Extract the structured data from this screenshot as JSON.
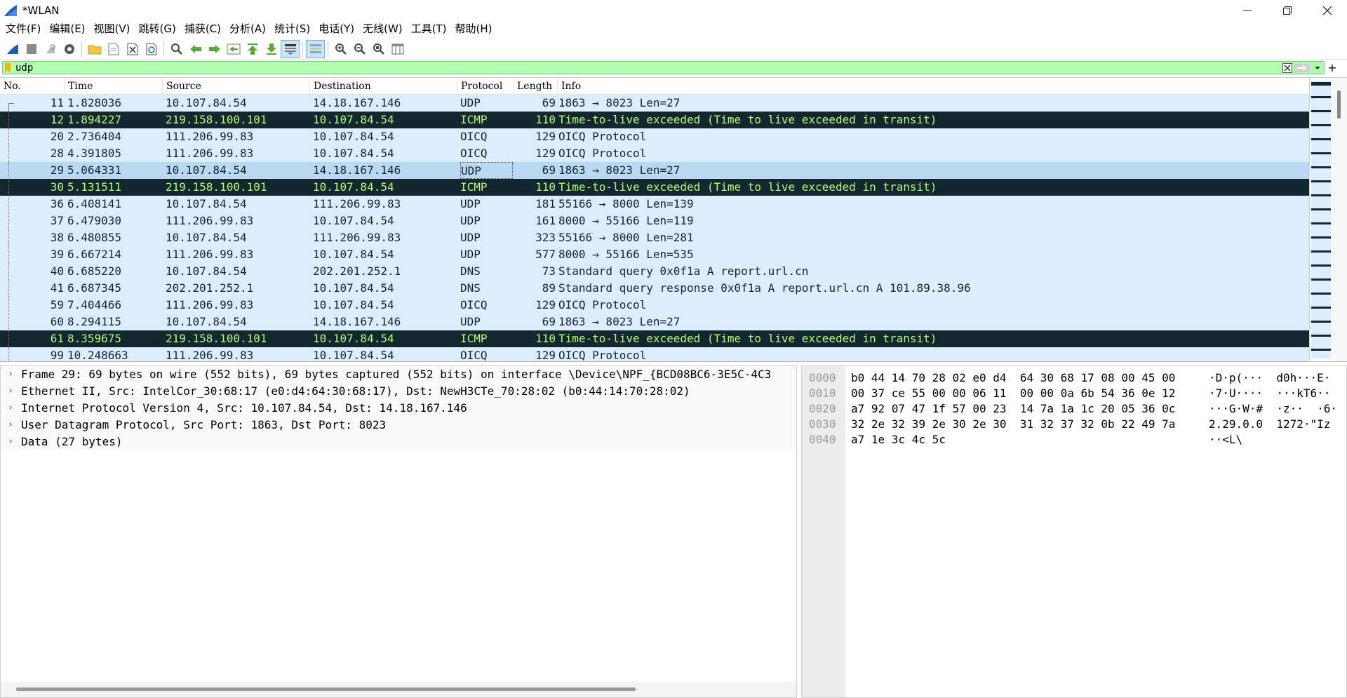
{
  "window": {
    "title": "*WLAN"
  },
  "menu": [
    "文件(F)",
    "编辑(E)",
    "视图(V)",
    "跳转(G)",
    "捕获(C)",
    "分析(A)",
    "统计(S)",
    "电话(Y)",
    "无线(W)",
    "工具(T)",
    "帮助(H)"
  ],
  "filter": {
    "value": "udp",
    "add_label": "+"
  },
  "columns": [
    "No.",
    "Time",
    "Source",
    "Destination",
    "Protocol",
    "Length",
    "Info"
  ],
  "packets": [
    {
      "no": "11",
      "time": "1.828036",
      "src": "10.107.84.54",
      "dst": "14.18.167.146",
      "proto": "UDP",
      "len": "69",
      "info": "1863 → 8023 Len=27"
    },
    {
      "no": "12",
      "time": "1.894227",
      "src": "219.158.100.101",
      "dst": "10.107.84.54",
      "proto": "ICMP",
      "len": "110",
      "info": "Time-to-live exceeded (Time to live exceeded in transit)"
    },
    {
      "no": "20",
      "time": "2.736404",
      "src": "111.206.99.83",
      "dst": "10.107.84.54",
      "proto": "OICQ",
      "len": "129",
      "info": "OICQ Protocol"
    },
    {
      "no": "28",
      "time": "4.391805",
      "src": "111.206.99.83",
      "dst": "10.107.84.54",
      "proto": "OICQ",
      "len": "129",
      "info": "OICQ Protocol"
    },
    {
      "no": "29",
      "time": "5.064331",
      "src": "10.107.84.54",
      "dst": "14.18.167.146",
      "proto": "UDP",
      "len": "69",
      "info": "1863 → 8023 Len=27"
    },
    {
      "no": "30",
      "time": "5.131511",
      "src": "219.158.100.101",
      "dst": "10.107.84.54",
      "proto": "ICMP",
      "len": "110",
      "info": "Time-to-live exceeded (Time to live exceeded in transit)"
    },
    {
      "no": "36",
      "time": "6.408141",
      "src": "10.107.84.54",
      "dst": "111.206.99.83",
      "proto": "UDP",
      "len": "181",
      "info": "55166 → 8000 Len=139"
    },
    {
      "no": "37",
      "time": "6.479030",
      "src": "111.206.99.83",
      "dst": "10.107.84.54",
      "proto": "UDP",
      "len": "161",
      "info": "8000 → 55166 Len=119"
    },
    {
      "no": "38",
      "time": "6.480855",
      "src": "10.107.84.54",
      "dst": "111.206.99.83",
      "proto": "UDP",
      "len": "323",
      "info": "55166 → 8000 Len=281"
    },
    {
      "no": "39",
      "time": "6.667214",
      "src": "111.206.99.83",
      "dst": "10.107.84.54",
      "proto": "UDP",
      "len": "577",
      "info": "8000 → 55166 Len=535"
    },
    {
      "no": "40",
      "time": "6.685220",
      "src": "10.107.84.54",
      "dst": "202.201.252.1",
      "proto": "DNS",
      "len": "73",
      "info": "Standard query 0x0f1a A report.url.cn"
    },
    {
      "no": "41",
      "time": "6.687345",
      "src": "202.201.252.1",
      "dst": "10.107.84.54",
      "proto": "DNS",
      "len": "89",
      "info": "Standard query response 0x0f1a A report.url.cn A 101.89.38.96"
    },
    {
      "no": "59",
      "time": "7.404466",
      "src": "111.206.99.83",
      "dst": "10.107.84.54",
      "proto": "OICQ",
      "len": "129",
      "info": "OICQ Protocol"
    },
    {
      "no": "60",
      "time": "8.294115",
      "src": "10.107.84.54",
      "dst": "14.18.167.146",
      "proto": "UDP",
      "len": "69",
      "info": "1863 → 8023 Len=27"
    },
    {
      "no": "61",
      "time": "8.359675",
      "src": "219.158.100.101",
      "dst": "10.107.84.54",
      "proto": "ICMP",
      "len": "110",
      "info": "Time-to-live exceeded (Time to live exceeded in transit)"
    },
    {
      "no": "99",
      "time": "10.248663",
      "src": "111.206.99.83",
      "dst": "10.107.84.54",
      "proto": "OICQ",
      "len": "129",
      "info": "OICQ Protocol"
    }
  ],
  "selected_packet_no": "29",
  "details": [
    "Frame 29: 69 bytes on wire (552 bits), 69 bytes captured (552 bits) on interface \\Device\\NPF_{BCD08BC6-3E5C-4C3",
    "Ethernet II, Src: IntelCor_30:68:17 (e0:d4:64:30:68:17), Dst: NewH3CTe_70:28:02 (b0:44:14:70:28:02)",
    "Internet Protocol Version 4, Src: 10.107.84.54, Dst: 14.18.167.146",
    "User Datagram Protocol, Src Port: 1863, Dst Port: 8023",
    "Data (27 bytes)"
  ],
  "bytes": [
    {
      "offset": "0000",
      "hex": "b0 44 14 70 28 02 e0 d4  64 30 68 17 08 00 45 00",
      "ascii": "·D·p(···  d0h···E·"
    },
    {
      "offset": "0010",
      "hex": "00 37 ce 55 00 00 06 11  00 00 0a 6b 54 36 0e 12",
      "ascii": "·7·U····  ···kT6··"
    },
    {
      "offset": "0020",
      "hex": "a7 92 07 47 1f 57 00 23  14 7a 1a 1c 20 05 36 0c",
      "ascii": "···G·W·#  ·z··  ·6·"
    },
    {
      "offset": "0030",
      "hex": "32 2e 32 39 2e 30 2e 30  31 32 37 32 0b 22 49 7a",
      "ascii": "2.29.0.0  1272·\"Iz"
    },
    {
      "offset": "0040",
      "hex": "a7 1e 3c 4c 5c",
      "ascii": "··<L\\"
    }
  ],
  "colors": {
    "udp_bg": "#daeeff",
    "icmp_bg": "#12272e",
    "icmp_fg": "#b5fa7a",
    "filter_ok": "#afffaf",
    "selected_bg": "#b9d8f2"
  }
}
